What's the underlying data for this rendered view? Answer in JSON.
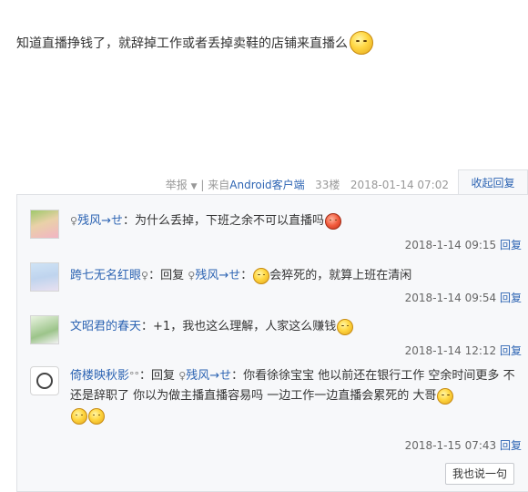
{
  "post": {
    "text": "知道直播挣钱了，就辞掉工作或者丢掉卖鞋的店铺来直播么",
    "emoji": "smile-emoji"
  },
  "meta": {
    "report": "举报",
    "separator": "|",
    "from_prefix": "来自",
    "client": "Android客户端",
    "floor": "33楼",
    "datetime": "2018-01-14 07:02",
    "collapse_label": "收起回复"
  },
  "replies": [
    {
      "pin": "♀",
      "user": "残风→せ",
      "colon": "：",
      "text": "为什么丢掉，下班之余不可以直播吗",
      "emoji": "angry-emoji",
      "time": "2018-1-14 09:15",
      "reply_label": "回复"
    },
    {
      "user": "跨七无名红眼",
      "pin": "♀",
      "colon": "：",
      "reply_kw": "回复",
      "target_pin": "♀",
      "target": "残风→せ",
      "colon2": "：",
      "text": "会猝死的，就算上班在清闲",
      "emoji": "smile-emoji",
      "time": "2018-1-14 09:54",
      "reply_label": "回复"
    },
    {
      "user": "文昭君的春天",
      "colon": "：",
      "text": "+1，我也这么理解，人家这么赚钱",
      "emoji": "smile-emoji",
      "time": "2018-1-14 12:12",
      "reply_label": "回复"
    },
    {
      "user": "倚楼映秋影",
      "degree": "°°",
      "colon": "：",
      "reply_kw": "回复",
      "target_pin": "♀",
      "target": "残风→せ",
      "colon2": "：",
      "text": "你看徐徐宝宝 他以前还在银行工作 空余时间更多 不还是辞职了 你以为做主播直播容易吗 一边工作一边直播会累死的 大哥",
      "emoji": "smile-emoji",
      "time": "2018-1-15 07:43",
      "reply_label": "回复"
    }
  ],
  "say_button": "我也说一句"
}
